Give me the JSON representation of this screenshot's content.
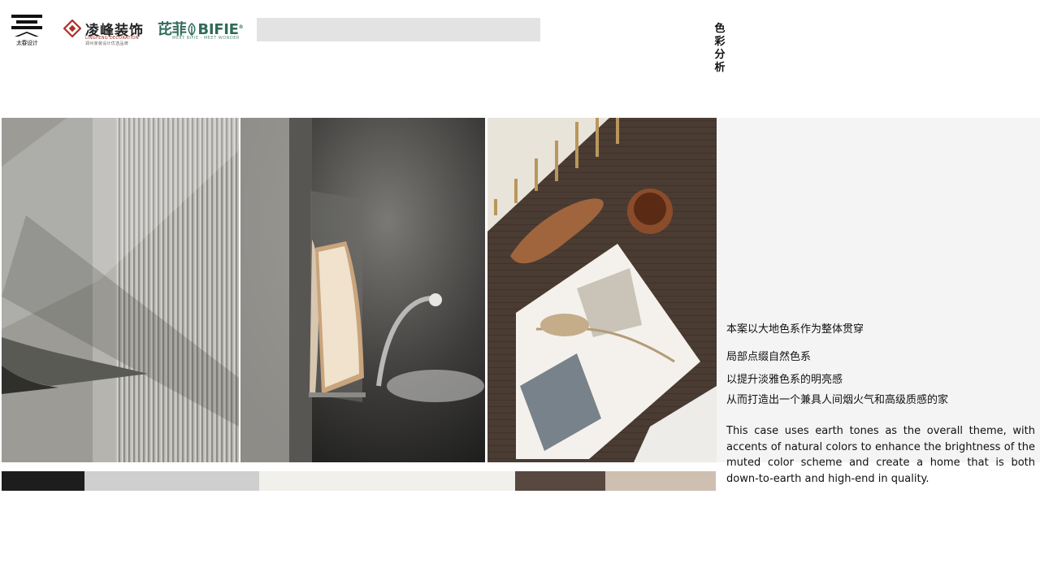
{
  "header": {
    "brand_main": {
      "name": "太春设计"
    },
    "brand_lingfeng": {
      "name": "凌峰装饰",
      "sub": "LINGFENG DECORATION",
      "sub2": "郑州家装设计优选品牌"
    },
    "brand_bifie": {
      "name": "芘菲",
      "latin": "BIFIE",
      "mark": "®",
      "sub": "MEET BIFIE · MEET WONDER"
    },
    "section_title": "色彩分析"
  },
  "palette": {
    "swatches": [
      {
        "name": "charcoal",
        "color": "#1d1d1d"
      },
      {
        "name": "light-grey",
        "color": "#cfcfcf"
      },
      {
        "name": "off-white",
        "color": "#f2f0eb"
      },
      {
        "name": "dark-brown",
        "color": "#574840"
      },
      {
        "name": "sand",
        "color": "#cfbfb1"
      }
    ]
  },
  "description": {
    "cn_lines": [
      "本案以大地色系作为整体贯穿",
      "局部点缀自然色系",
      "以提升淡雅色系的明亮感",
      "从而打造出一个兼具人间烟火气和高级质感的家"
    ],
    "en": "This case uses earth tones as the overall theme, with accents of natural colors to enhance the brightness of the muted color scheme and create a home that is both down-to-earth and high-end in quality."
  }
}
